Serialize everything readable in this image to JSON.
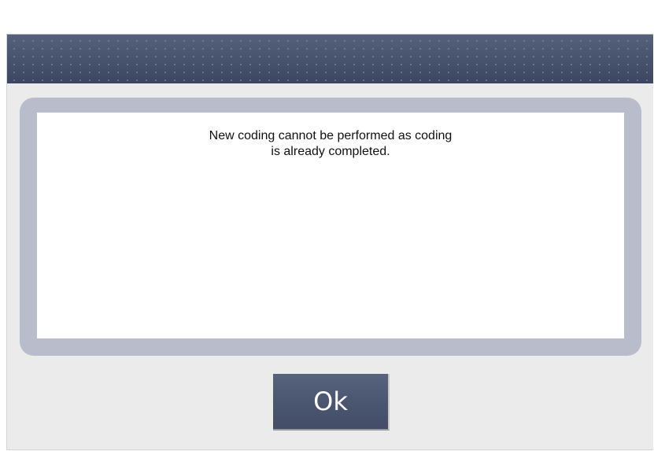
{
  "dialog": {
    "message": "New coding cannot be performed as coding\nis already completed.",
    "ok_label": "Ok"
  },
  "colors": {
    "header": "#4b5670",
    "panel_border": "#b8bccb",
    "background": "#ebebeb",
    "button": "#4a5570"
  }
}
